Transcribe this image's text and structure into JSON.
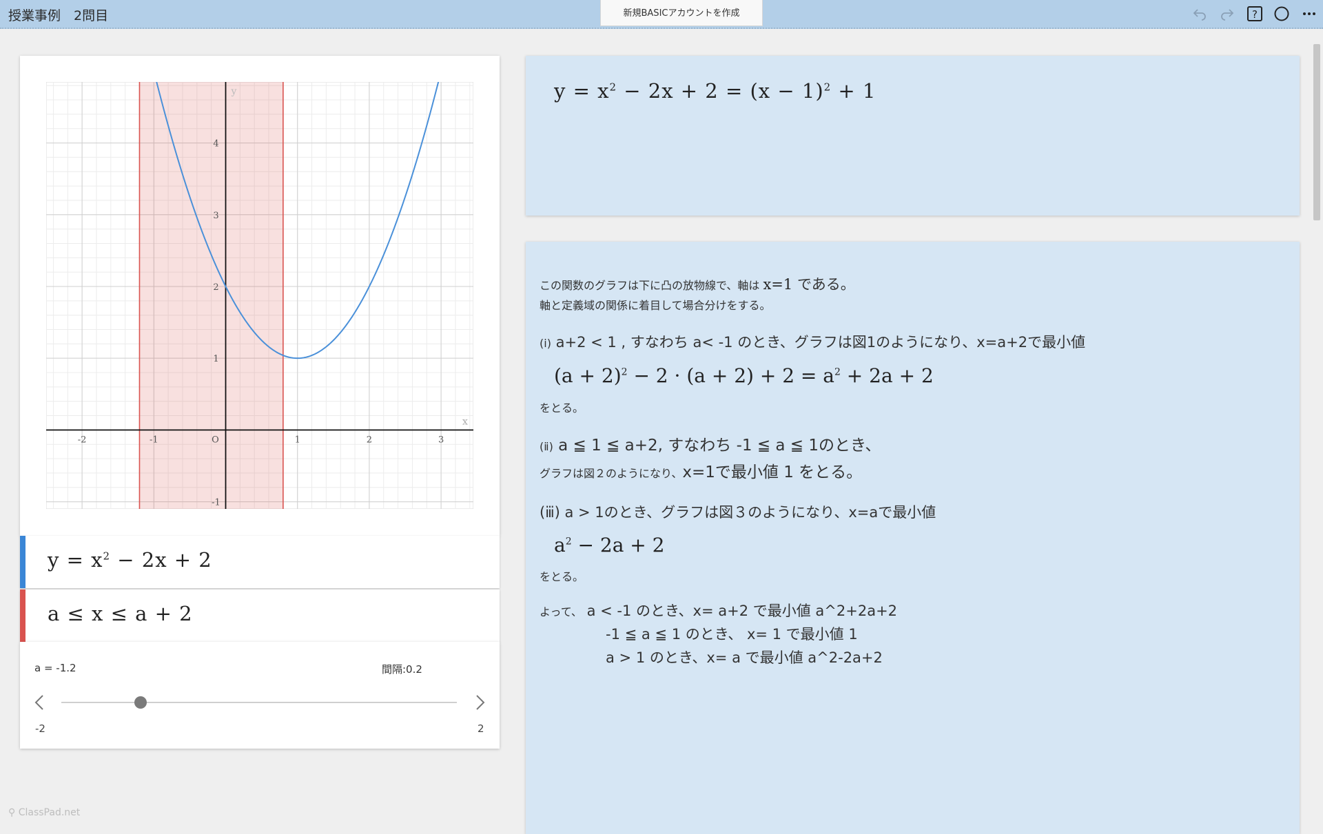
{
  "app": {
    "title": "授業事例　2問目",
    "create_account": "新規BASICアカウントを作成",
    "watermark": "ClassPad.net"
  },
  "toolbar": {
    "icons": [
      "undo-icon",
      "redo-icon",
      "help-icon",
      "circle-icon",
      "more-icon"
    ]
  },
  "chart_data": {
    "type": "line",
    "xlim": [
      -2.5,
      3.45
    ],
    "ylim": [
      -1.1,
      4.85
    ],
    "x_ticks": [
      "-2",
      "-1",
      "O",
      "1",
      "2",
      "3"
    ],
    "y_ticks": [
      "-1",
      "1",
      "2",
      "3",
      "4"
    ],
    "xlabel": "x",
    "ylabel": "y",
    "grid": true,
    "series": [
      {
        "name": "y=x^2-2x+2",
        "function": "x^2-2x+2",
        "color": "#4a90d9"
      }
    ],
    "shaded_region": {
      "from": -1.2,
      "to": 0.8,
      "color": "#d9534f"
    }
  },
  "expressions": [
    {
      "color": "#3a86d6",
      "main": "y",
      "text": "y = x",
      "sup": "2",
      "rest": " − 2x + 2"
    },
    {
      "color": "#d9534f",
      "text": "a ≤ x ≤ a + 2"
    }
  ],
  "slider": {
    "label": "a = -1.2",
    "value": -1.2,
    "step_label": "間隔:0.2",
    "min_label": "-2",
    "max_label": "2",
    "min": -2,
    "max": 2
  },
  "note1": {
    "eq_a": "y = x",
    "eq_sup1": "2",
    "eq_b": " − 2x + 2 = (x − 1)",
    "eq_sup2": "2",
    "eq_c": " + 1"
  },
  "note2": {
    "intro1_a": "この関数のグラフは下に凸の放物線で、軸は ",
    "intro1_b": "x=1",
    "intro1_c": " である。",
    "intro2": "軸と定義域の関係に着目して場合分けをする。",
    "case1_label": "(ⅰ)",
    "case1": " a+2 < 1 , すなわち a< -1 のとき、グラフは図1のようになり、x=a+2で最小値",
    "case1_eq_a": "(a + 2)",
    "case1_eq_sup1": "2",
    "case1_eq_b": " − 2 · (a + 2) + 2 = a",
    "case1_eq_sup2": "2",
    "case1_eq_c": " + 2a + 2",
    "case1_end": "をとる。",
    "case2_label": "(ⅱ)",
    "case2": " a ≦ 1 ≦ a+2, すなわち -1 ≦ a ≦ 1のとき、",
    "case2b_a": "グラフは図２のようになり、",
    "case2b_b": "x=1で最小値 1 をとる。",
    "case3_label": "(ⅲ)",
    "case3": " a > 1のとき、グラフは図３のようになり、x=aで最小値",
    "case3_eq_a": "a",
    "case3_eq_sup": "2",
    "case3_eq_b": " − 2a + 2",
    "case3_end": "をとる。",
    "concl1_a": "よって、",
    "concl1_b": " a < -1 のとき、x= a+2 で最小値 a^2+2a+2",
    "concl2": "-1 ≦ a ≦ 1 のとき、 x= 1 で最小値 1",
    "concl3": "a > 1 のとき、x= a で最小値 a^2-2a+2"
  }
}
